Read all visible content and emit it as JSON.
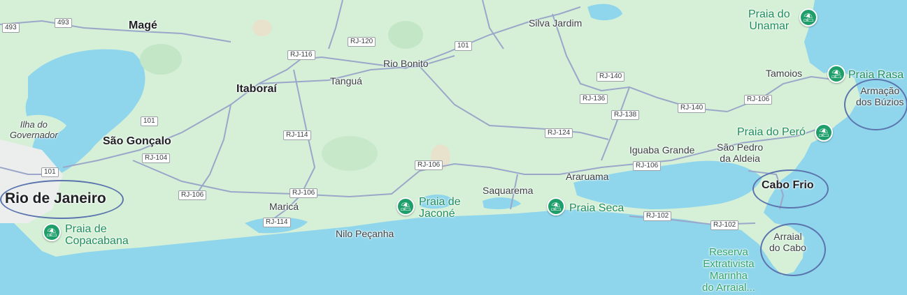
{
  "map": {
    "places": [
      {
        "id": "mage",
        "text": "Magé",
        "cls": "city"
      },
      {
        "id": "itaborai",
        "text": "Itaboraí",
        "cls": "city"
      },
      {
        "id": "tangua",
        "text": "Tanguá",
        "cls": "town"
      },
      {
        "id": "rio-bonito",
        "text": "Rio Bonito",
        "cls": "town"
      },
      {
        "id": "silva-jardim",
        "text": "Silva Jardim",
        "cls": "town"
      },
      {
        "id": "tamoios",
        "text": "Tamoios",
        "cls": "town"
      },
      {
        "id": "ilha-governador",
        "text": "Ilha do\nGovernador",
        "cls": "italic"
      },
      {
        "id": "sao-goncalo",
        "text": "São Gonçalo",
        "cls": "city"
      },
      {
        "id": "rio-de-janeiro",
        "text": "Rio de Janeiro",
        "cls": "major"
      },
      {
        "id": "marica",
        "text": "Maricá",
        "cls": "town"
      },
      {
        "id": "nilo-pecanha",
        "text": "Nilo Peçanha",
        "cls": "town"
      },
      {
        "id": "saquarema",
        "text": "Saquarema",
        "cls": "town"
      },
      {
        "id": "araruama",
        "text": "Araruama",
        "cls": "town"
      },
      {
        "id": "iguaba-grande",
        "text": "Iguaba Grande",
        "cls": "town"
      },
      {
        "id": "sao-pedro",
        "text": "São Pedro\nda Aldeia",
        "cls": "town"
      },
      {
        "id": "cabo-frio",
        "text": "Cabo Frio",
        "cls": "city"
      },
      {
        "id": "arraial",
        "text": "Arraial\ndo Cabo",
        "cls": "town"
      },
      {
        "id": "armacao",
        "text": "Armação\ndos Búzios",
        "cls": "town"
      },
      {
        "id": "reserva",
        "text": "Reserva\nExtrativista\nMarinha\ndo Arraial...",
        "cls": "reserve"
      }
    ],
    "beaches": [
      {
        "id": "unamar",
        "text": "Praia do\nUnamar",
        "icon": "beach-umbrella-icon"
      },
      {
        "id": "rasa",
        "text": "Praia Rasa",
        "icon": "beach-umbrella-icon"
      },
      {
        "id": "pero",
        "text": "Praia do Peró",
        "icon": "beach-umbrella-icon"
      },
      {
        "id": "jacone",
        "text": "Praia de\nJaconé",
        "icon": "beach-umbrella-icon"
      },
      {
        "id": "seca",
        "text": "Praia Seca",
        "icon": "beach-umbrella-icon"
      },
      {
        "id": "copacabana",
        "text": "Praia de\nCopacabana",
        "icon": "beach-umbrella-icon"
      }
    ],
    "roads": [
      {
        "id": "r493a",
        "text": "493"
      },
      {
        "id": "r493b",
        "text": "493"
      },
      {
        "id": "rj120",
        "text": "RJ-120"
      },
      {
        "id": "rj116",
        "text": "RJ-116"
      },
      {
        "id": "br101a",
        "text": "101"
      },
      {
        "id": "rj140a",
        "text": "RJ-140"
      },
      {
        "id": "rj136",
        "text": "RJ-136"
      },
      {
        "id": "rj138",
        "text": "RJ-138"
      },
      {
        "id": "rj140b",
        "text": "RJ-140"
      },
      {
        "id": "rj106a",
        "text": "RJ-106"
      },
      {
        "id": "br101b",
        "text": "101"
      },
      {
        "id": "rj104",
        "text": "RJ-104"
      },
      {
        "id": "rj114a",
        "text": "RJ-114"
      },
      {
        "id": "rj124",
        "text": "RJ-124"
      },
      {
        "id": "rj106b",
        "text": "RJ-106"
      },
      {
        "id": "rj106c",
        "text": "RJ-106"
      },
      {
        "id": "br101c",
        "text": "101"
      },
      {
        "id": "rj106d",
        "text": "RJ-106"
      },
      {
        "id": "rj106e",
        "text": "RJ-106"
      },
      {
        "id": "rj114b",
        "text": "RJ-114"
      },
      {
        "id": "rj102a",
        "text": "RJ-102"
      },
      {
        "id": "rj102b",
        "text": "RJ-102"
      }
    ],
    "highlight_color": "#5b74ad",
    "land_color": "#d6f0d8",
    "water_color": "#8fd6ec",
    "road_color": "#9aa7c9"
  }
}
